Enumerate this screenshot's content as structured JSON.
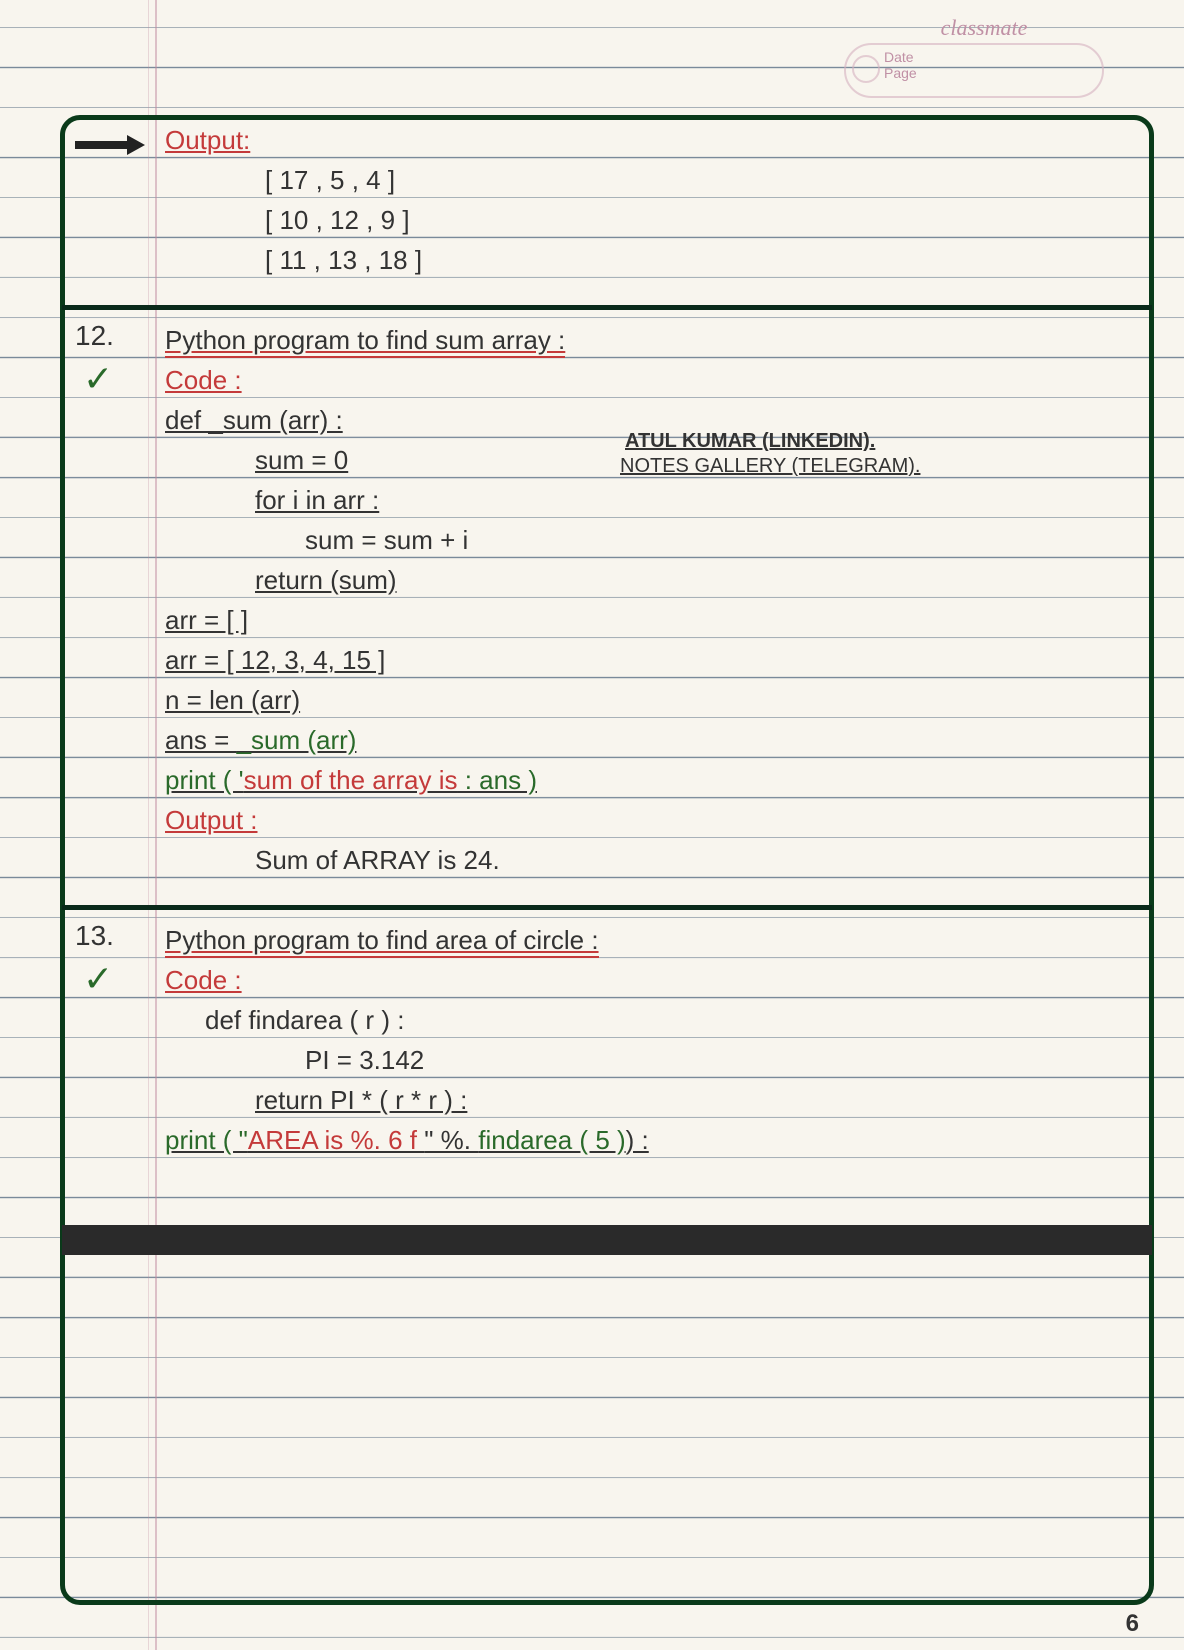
{
  "header": {
    "brand": "classmate",
    "date_label": "Date",
    "page_label": "Page"
  },
  "page_number": "6",
  "credits": {
    "line1": "ATUL KUMAR (LINKEDIN).",
    "line2": "NOTES GALLERY (TELEGRAM)."
  },
  "margin": {
    "q12": "12.",
    "q13": "13."
  },
  "section_output_top": {
    "label": "Output:",
    "row1": "[ 17 , 5 , 4 ]",
    "row2": "[ 10 , 12 , 9 ]",
    "row3": "[ 11 , 13 , 18 ]"
  },
  "q12": {
    "title": "Python program to find sum array :",
    "code_label": "Code :",
    "l1": "def _sum (arr) :",
    "l2": "sum = 0",
    "l3": "for i in arr :",
    "l4": "sum = sum + i",
    "l5": "return (sum)",
    "l6": "arr = [ ]",
    "l7": "arr = [ 12, 3, 4, 15 ]",
    "l8": "n = len (arr)",
    "l9a": "ans = ",
    "l9b": "_sum (arr)",
    "l10a": "print ( '",
    "l10b": "sum of the array is",
    "l10c": " : ans )",
    "output_label": "Output :",
    "output_val": "Sum of ARRAY is 24."
  },
  "q13": {
    "title": "Python program to find area of circle :",
    "code_label": "Code :",
    "l1": "def findarea ( r ) :",
    "l2": "PI = 3.142",
    "l3": "return PI * ( r * r ) :",
    "l4a": "print ( \"",
    "l4b": "AREA is %. 6 f ",
    "l4c": "\" %. ",
    "l4d": "findarea ( 5 )",
    "l4e": ") :"
  }
}
